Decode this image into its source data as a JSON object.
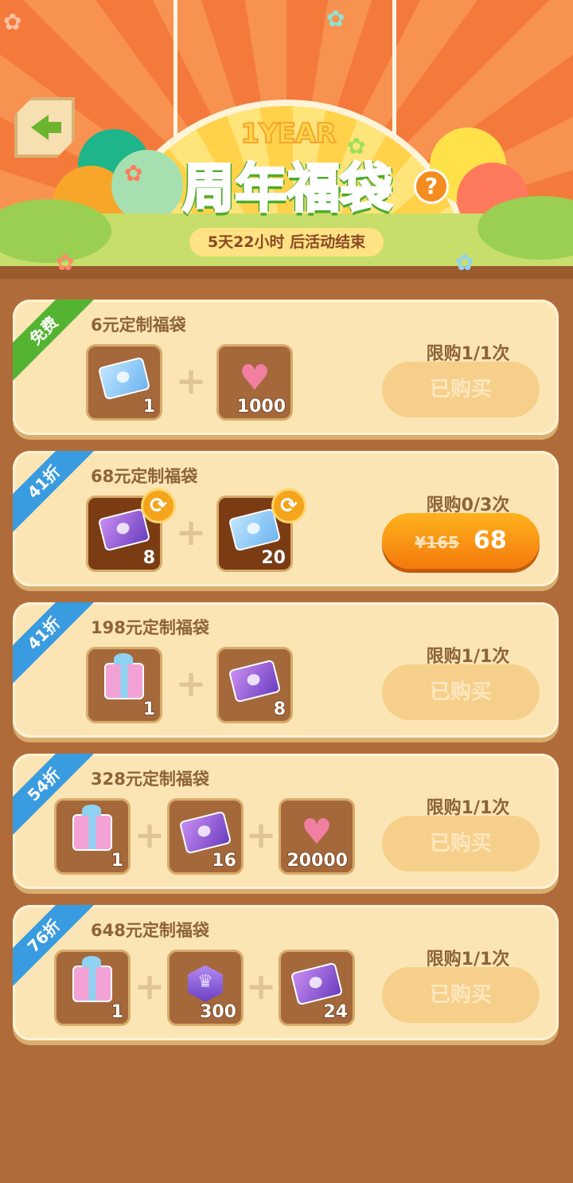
{
  "header": {
    "year_text": "1YEAR",
    "title": "周年福袋",
    "timer": "5天22小时 后活动结束",
    "help_label": "?"
  },
  "offers": [
    {
      "badge": "免费",
      "title": "6元定制福袋",
      "limit": "限购1/1次",
      "button": "已购买",
      "items": [
        {
          "icon": "blue-ticket-icon",
          "count": "1"
        },
        {
          "icon": "heart-icon",
          "count": "1000"
        }
      ]
    },
    {
      "badge": "41折",
      "title": "68元定制福袋",
      "limit": "限购0/3次",
      "old_price": "¥165",
      "price": "68",
      "items": [
        {
          "icon": "purple-ticket-icon",
          "count": "8"
        },
        {
          "icon": "blue-ticket-icon",
          "count": "20"
        }
      ]
    },
    {
      "badge": "41折",
      "title": "198元定制福袋",
      "limit": "限购1/1次",
      "button": "已购买",
      "items": [
        {
          "icon": "gift-box-icon",
          "count": "1"
        },
        {
          "icon": "purple-ticket-icon",
          "count": "8"
        }
      ]
    },
    {
      "badge": "54折",
      "title": "328元定制福袋",
      "limit": "限购1/1次",
      "button": "已购买",
      "items": [
        {
          "icon": "gift-box-icon",
          "count": "1"
        },
        {
          "icon": "purple-ticket-icon",
          "count": "16"
        },
        {
          "icon": "heart-icon",
          "count": "20000"
        }
      ]
    },
    {
      "badge": "76折",
      "title": "648元定制福袋",
      "limit": "限购1/1次",
      "button": "已购买",
      "items": [
        {
          "icon": "gift-box-icon",
          "count": "1"
        },
        {
          "icon": "crown-hexagon-icon",
          "count": "300"
        },
        {
          "icon": "purple-ticket-icon",
          "count": "24"
        }
      ]
    }
  ],
  "plus_sign": "+",
  "colors": {
    "sunburst": "#f47a3c",
    "card": "#fbe5b5",
    "free_badge": "#54b432",
    "discount_badge": "#3a9ce0",
    "buy_button": "#f47a0c",
    "purchased_button": "#f6cf8a"
  }
}
